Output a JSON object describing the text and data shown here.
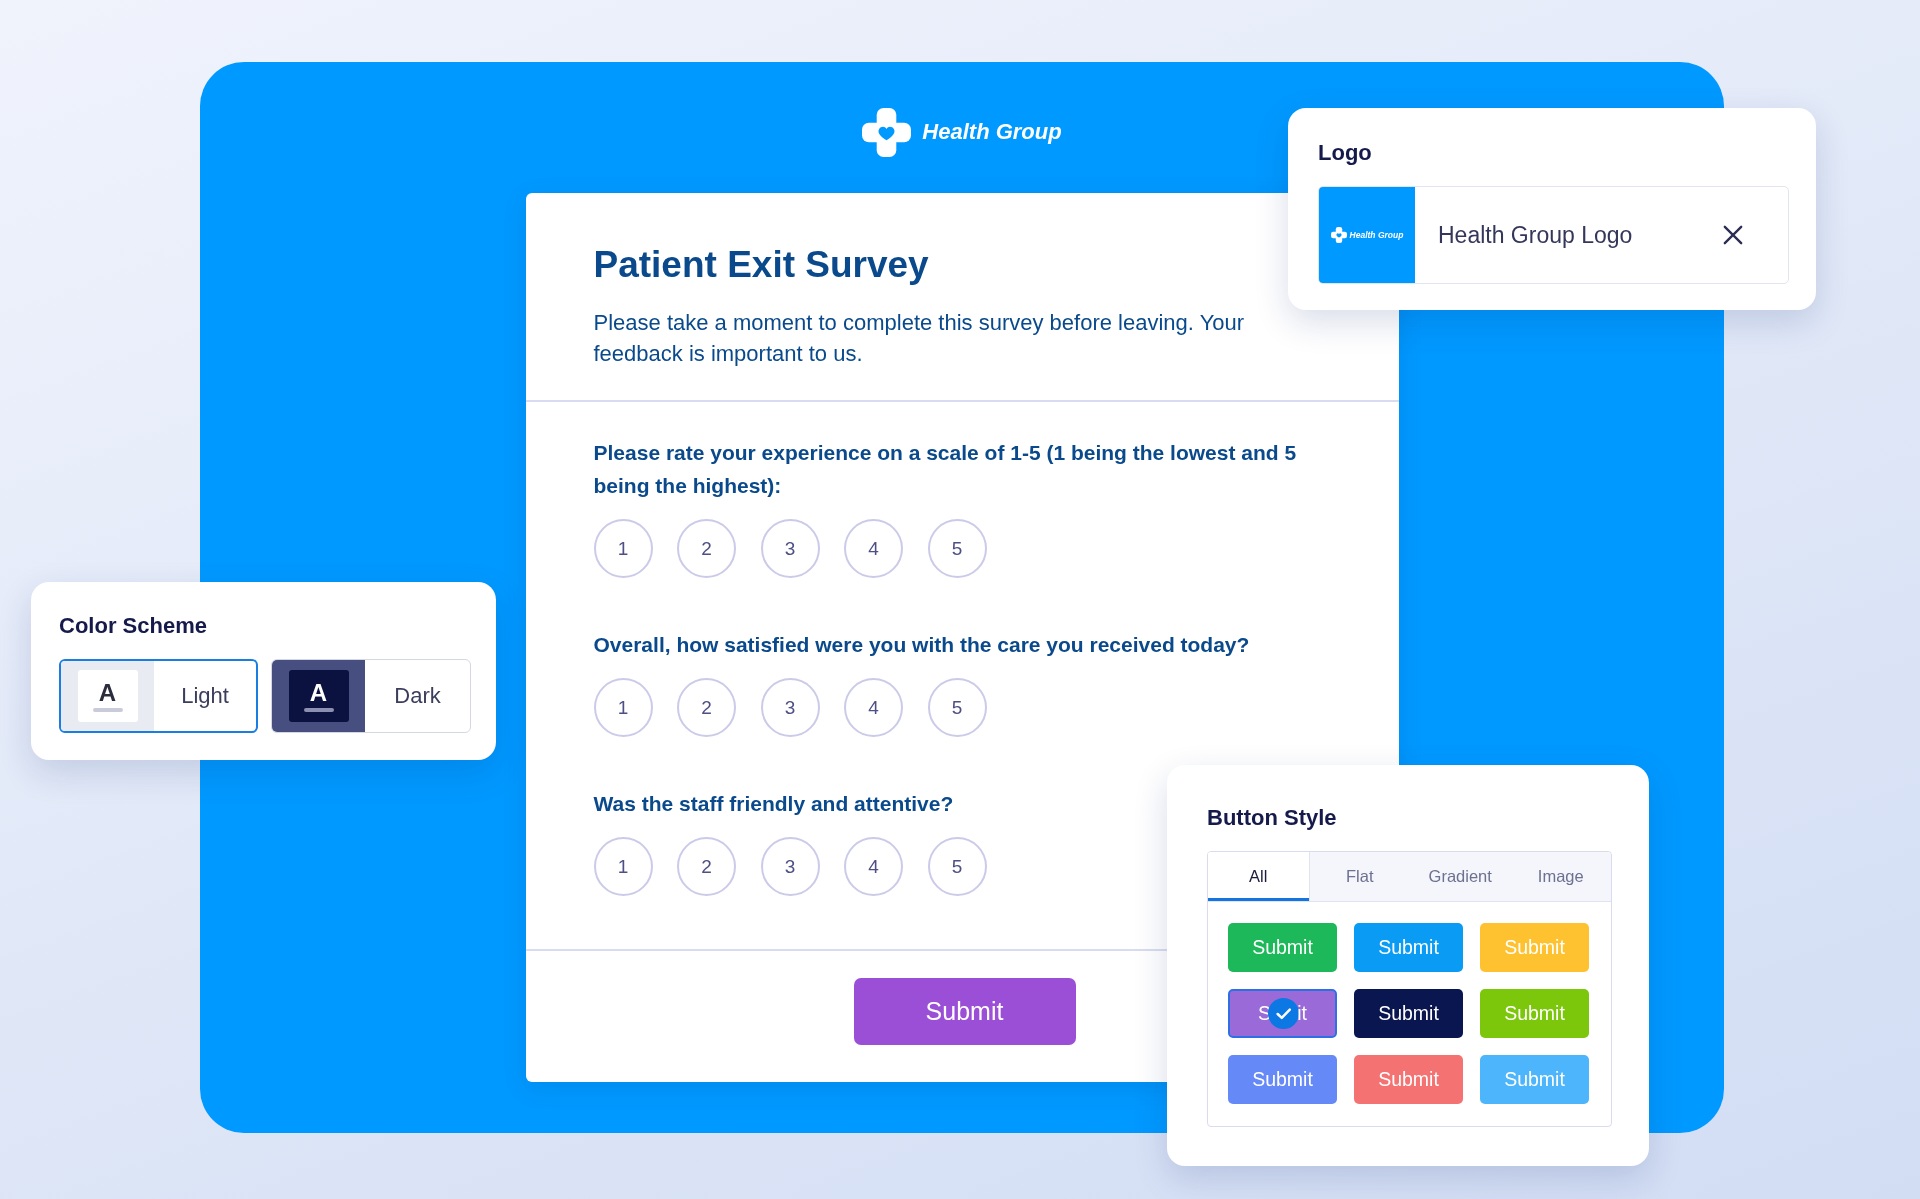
{
  "brand": {
    "name": "Health Group"
  },
  "survey": {
    "title": "Patient Exit Survey",
    "description": "Please take a moment to complete this survey before leaving. Your feedback is important to us.",
    "questions": [
      {
        "text": "Please rate your experience on a scale of 1-5 (1 being the lowest and 5 being the highest):",
        "options": [
          {
            "label": "1",
            "selected": false
          },
          {
            "label": "2",
            "selected": false
          },
          {
            "label": "3",
            "selected": false
          },
          {
            "label": "4",
            "selected": false
          },
          {
            "label": "5",
            "selected": false
          }
        ]
      },
      {
        "text": "Overall, how satisfied were you with the care you received today?",
        "options": [
          {
            "label": "1",
            "selected": false
          },
          {
            "label": "2",
            "selected": false
          },
          {
            "label": "3",
            "selected": false
          },
          {
            "label": "4",
            "selected": false
          },
          {
            "label": "5",
            "selected": false
          }
        ]
      },
      {
        "text": "Was the staff friendly and attentive?",
        "options": [
          {
            "label": "1",
            "selected": false
          },
          {
            "label": "2",
            "selected": false
          },
          {
            "label": "3",
            "selected": false
          },
          {
            "label": "4",
            "selected": false
          },
          {
            "label": "5",
            "selected": false
          }
        ]
      }
    ],
    "submit_label": "Submit"
  },
  "logo_panel": {
    "title": "Logo",
    "file": {
      "thumbnail_label": "Health Group",
      "name": "Health Group Logo"
    }
  },
  "color_scheme_panel": {
    "title": "Color Scheme",
    "options": [
      {
        "kind": "light",
        "swatch_letter": "A",
        "label": "Light",
        "selected": true
      },
      {
        "kind": "dark",
        "swatch_letter": "A",
        "label": "Dark",
        "selected": false
      }
    ]
  },
  "button_style_panel": {
    "title": "Button Style",
    "tabs": [
      {
        "label": "All",
        "selected": true
      },
      {
        "label": "Flat",
        "selected": false
      },
      {
        "label": "Gradient",
        "selected": false
      },
      {
        "label": "Image",
        "selected": false
      }
    ],
    "styles": [
      {
        "label": "Submit",
        "color": "#1cb859",
        "selected": false
      },
      {
        "label": "Submit",
        "color": "#0a9cf5",
        "selected": false
      },
      {
        "label": "Submit",
        "color": "#fec230",
        "selected": false
      },
      {
        "label": "S",
        "label_end": "it",
        "color": "#9a6ad9",
        "selected": true
      },
      {
        "label": "Submit",
        "color": "#0a164f",
        "selected": false
      },
      {
        "label": "Submit",
        "color": "#7cc60b",
        "selected": false
      },
      {
        "label": "Submit",
        "color": "#6689f8",
        "selected": false
      },
      {
        "label": "Submit",
        "color": "#f47272",
        "selected": false
      },
      {
        "label": "Submit",
        "color": "#4db5fb",
        "selected": false
      }
    ]
  }
}
